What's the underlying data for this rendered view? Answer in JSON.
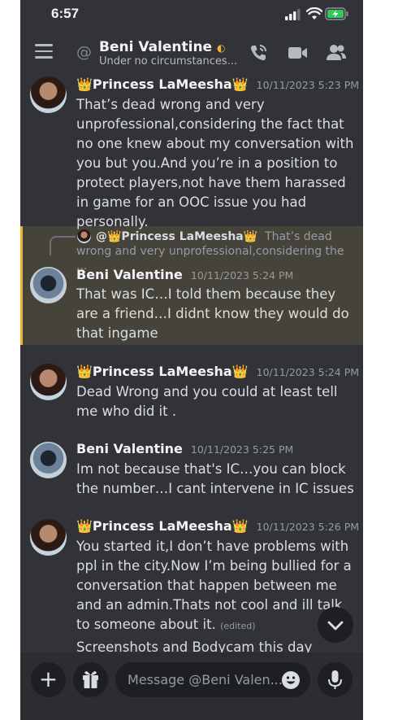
{
  "status_bar": {
    "time": "6:57"
  },
  "header": {
    "name": "Beni Valentine",
    "moon": "◐",
    "status": "Under no circumstances..."
  },
  "messages": [
    {
      "author": "👑Princess LaMeesha👑",
      "timestamp": "10/11/2023 5:23 PM",
      "text": "That’s dead wrong and very unprofessional,considering the fact that no one knew about my conversation with you but you.And you’re in a position to protect players,not have them harassed in game for an OOC issue you had personally."
    },
    {
      "reply_author": "@👑Princess LaMeesha👑",
      "reply_preview": "That’s dead wrong and very unprofessional,considering the ...",
      "author": "Beni Valentine",
      "timestamp": "10/11/2023 5:24 PM",
      "text": "That was IC…I told them because they are a friend…I didnt know they would do that ingame"
    },
    {
      "author": "👑Princess LaMeesha👑",
      "timestamp": "10/11/2023 5:24 PM",
      "text": "Dead Wrong and you could at least tell me who did it ."
    },
    {
      "author": "Beni Valentine",
      "timestamp": "10/11/2023 5:25 PM",
      "text": "Im not because that's IC…you can block the number…I cant intervene in IC issues"
    },
    {
      "author": "👑Princess LaMeesha👑",
      "timestamp": "10/11/2023 5:26 PM",
      "text": "You started it,I don’t have problems with ppl in the city.Now I’m being bullied for a conversation that happen between me and an admin.Thats not cool and ill talk to someone about it.",
      "edited": "(edited)",
      "text2": "Screenshots and Bodycam this day forward"
    }
  ],
  "composer": {
    "plus": "+",
    "placeholder": "Message @Beni Valen..."
  },
  "icons": {
    "menu": "hamburger-icon",
    "at": "at-icon",
    "call": "phone-call-icon",
    "video": "video-camera-icon",
    "members": "members-icon",
    "scroll": "chevron-down-icon",
    "gift": "gift-icon",
    "emoji": "emoji-icon",
    "mic": "microphone-icon"
  },
  "colors": {
    "background": "#313338",
    "highlight": "#46433b",
    "mention_bar": "#f0b232",
    "composer": "#2b2d31"
  }
}
